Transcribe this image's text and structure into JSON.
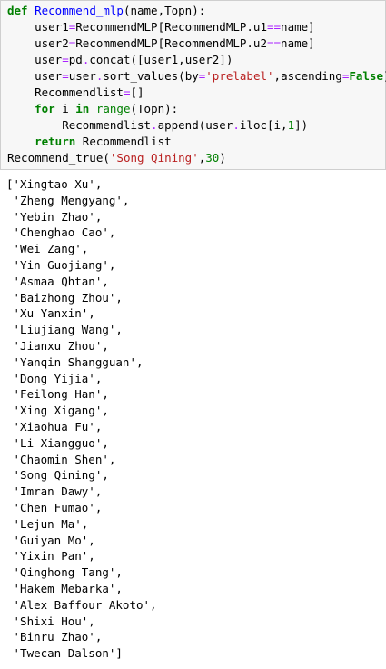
{
  "input_cell": {
    "lines": [
      [
        {
          "t": "def",
          "c": "kw"
        },
        {
          "t": " ",
          "c": ""
        },
        {
          "t": "Recommend_mlp",
          "c": "fn"
        },
        {
          "t": "(name,Topn):",
          "c": ""
        }
      ],
      [
        {
          "t": "    user1",
          "c": ""
        },
        {
          "t": "=",
          "c": "op"
        },
        {
          "t": "RecommendMLP[RecommendMLP.u1",
          "c": ""
        },
        {
          "t": "==",
          "c": "op"
        },
        {
          "t": "name]",
          "c": ""
        }
      ],
      [
        {
          "t": "    user2",
          "c": ""
        },
        {
          "t": "=",
          "c": "op"
        },
        {
          "t": "RecommendMLP[RecommendMLP.u2",
          "c": ""
        },
        {
          "t": "==",
          "c": "op"
        },
        {
          "t": "name]",
          "c": ""
        }
      ],
      [
        {
          "t": "    user",
          "c": ""
        },
        {
          "t": "=",
          "c": "op"
        },
        {
          "t": "pd",
          "c": ""
        },
        {
          "t": ".",
          "c": "op"
        },
        {
          "t": "concat([user1,user2])",
          "c": ""
        }
      ],
      [
        {
          "t": "    user",
          "c": ""
        },
        {
          "t": "=",
          "c": "op"
        },
        {
          "t": "user",
          "c": ""
        },
        {
          "t": ".",
          "c": "op"
        },
        {
          "t": "sort_values(by",
          "c": ""
        },
        {
          "t": "=",
          "c": "op"
        },
        {
          "t": "'prelabel'",
          "c": "str"
        },
        {
          "t": ",ascending",
          "c": ""
        },
        {
          "t": "=",
          "c": "op"
        },
        {
          "t": "False",
          "c": "kw"
        },
        {
          "t": ")",
          "c": ""
        }
      ],
      [
        {
          "t": "    Recommendlist",
          "c": ""
        },
        {
          "t": "=",
          "c": "op"
        },
        {
          "t": "[]",
          "c": ""
        }
      ],
      [
        {
          "t": "    ",
          "c": ""
        },
        {
          "t": "for",
          "c": "kw"
        },
        {
          "t": " i ",
          "c": ""
        },
        {
          "t": "in",
          "c": "kw"
        },
        {
          "t": " ",
          "c": ""
        },
        {
          "t": "range",
          "c": "bi"
        },
        {
          "t": "(Topn):",
          "c": ""
        }
      ],
      [
        {
          "t": "        Recommendlist",
          "c": ""
        },
        {
          "t": ".",
          "c": "op"
        },
        {
          "t": "append(user",
          "c": ""
        },
        {
          "t": ".",
          "c": "op"
        },
        {
          "t": "iloc[i,",
          "c": ""
        },
        {
          "t": "1",
          "c": "bi"
        },
        {
          "t": "])",
          "c": ""
        }
      ],
      [
        {
          "t": "    ",
          "c": ""
        },
        {
          "t": "return",
          "c": "kw"
        },
        {
          "t": " Recommendlist",
          "c": ""
        }
      ],
      [
        {
          "t": "Recommend_true(",
          "c": ""
        },
        {
          "t": "'Song Qining'",
          "c": "str"
        },
        {
          "t": ",",
          "c": ""
        },
        {
          "t": "30",
          "c": "bi"
        },
        {
          "t": ")",
          "c": ""
        }
      ]
    ]
  },
  "output": {
    "lines": [
      "['Xingtao Xu',",
      " 'Zheng Mengyang',",
      " 'Yebin Zhao',",
      " 'Chenghao Cao',",
      " 'Wei Zang',",
      " 'Yin Guojiang',",
      " 'Asmaa Qhtan',",
      " 'Baizhong Zhou',",
      " 'Xu Yanxin',",
      " 'Liujiang Wang',",
      " 'Jianxu Zhou',",
      " 'Yanqin Shangguan',",
      " 'Dong Yijia',",
      " 'Feilong Han',",
      " 'Xing Xigang',",
      " 'Xiaohua Fu',",
      " 'Li Xiangguo',",
      " 'Chaomin Shen',",
      " 'Song Qining',",
      " 'Imran Dawy',",
      " 'Chen Fumao',",
      " 'Lejun Ma',",
      " 'Guiyan Mo',",
      " 'Yixin Pan',",
      " 'Qinghong Tang',",
      " 'Hakem Mebarka',",
      " 'Alex Baffour Akoto',",
      " 'Shixi Hou',",
      " 'Binru Zhao',",
      " 'Twecan Dalson']"
    ]
  },
  "colors": {
    "cell_background": "#f7f7f7",
    "cell_border": "#cfcfcf",
    "keyword": "#008000",
    "function_name": "#0000ff",
    "operator": "#aa22ff",
    "string": "#ba2121"
  }
}
